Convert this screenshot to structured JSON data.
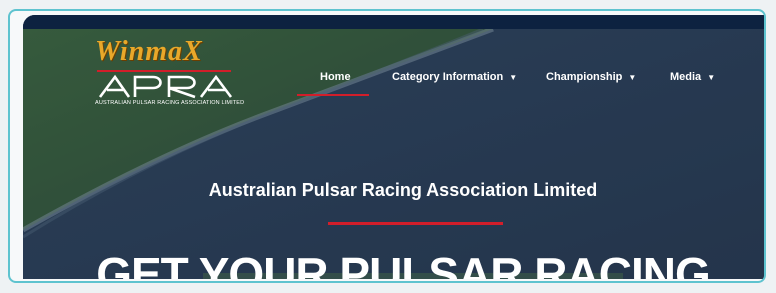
{
  "logo": {
    "brand": "WinmaX",
    "org_short": "APRA",
    "org_full": "AUSTRALIAN PULSAR RACING ASSOCIATION LIMITED"
  },
  "nav": {
    "home": "Home",
    "category": "Category Information",
    "championship": "Championship",
    "media": "Media",
    "active": "Home"
  },
  "hero": {
    "subtitle": "Australian Pulsar Racing Association Limited",
    "headline": "GET YOUR PULSAR RACING"
  },
  "colors": {
    "accent_red": "#d21e2a",
    "nav_bar": "#0d2240",
    "frame_border": "#5ec3cf",
    "logo_gold": "#e8a82a"
  }
}
